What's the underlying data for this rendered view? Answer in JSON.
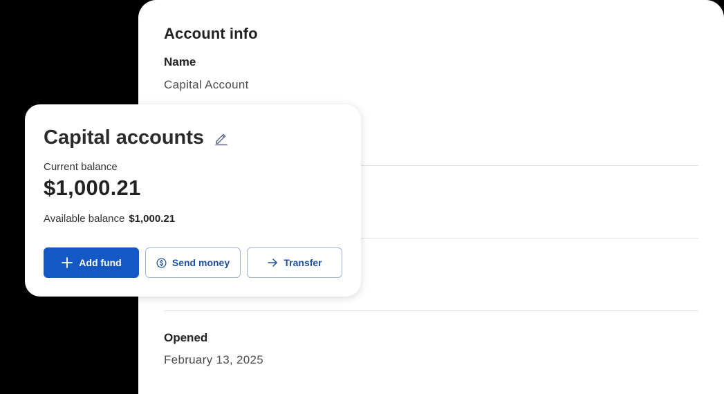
{
  "account_info": {
    "title": "Account info",
    "name_label": "Name",
    "name_value": "Capital Account",
    "opened_label": "Opened",
    "opened_value": "February 13, 2025"
  },
  "card": {
    "title": "Capital accounts",
    "current_balance_label": "Current balance",
    "current_balance_value": "$1,000.21",
    "available_balance_label": "Available balance",
    "available_balance_value": "$1,000.21",
    "buttons": {
      "add_fund": "Add fund",
      "send_money": "Send money",
      "transfer": "Transfer"
    },
    "icons": {
      "edit": "pencil-icon",
      "add": "plus-icon",
      "send": "dollar-circle-icon",
      "transfer": "arrow-right-icon"
    }
  },
  "colors": {
    "primary": "#1458c4",
    "outline_text": "#1c4fa0",
    "background": "#000000"
  }
}
